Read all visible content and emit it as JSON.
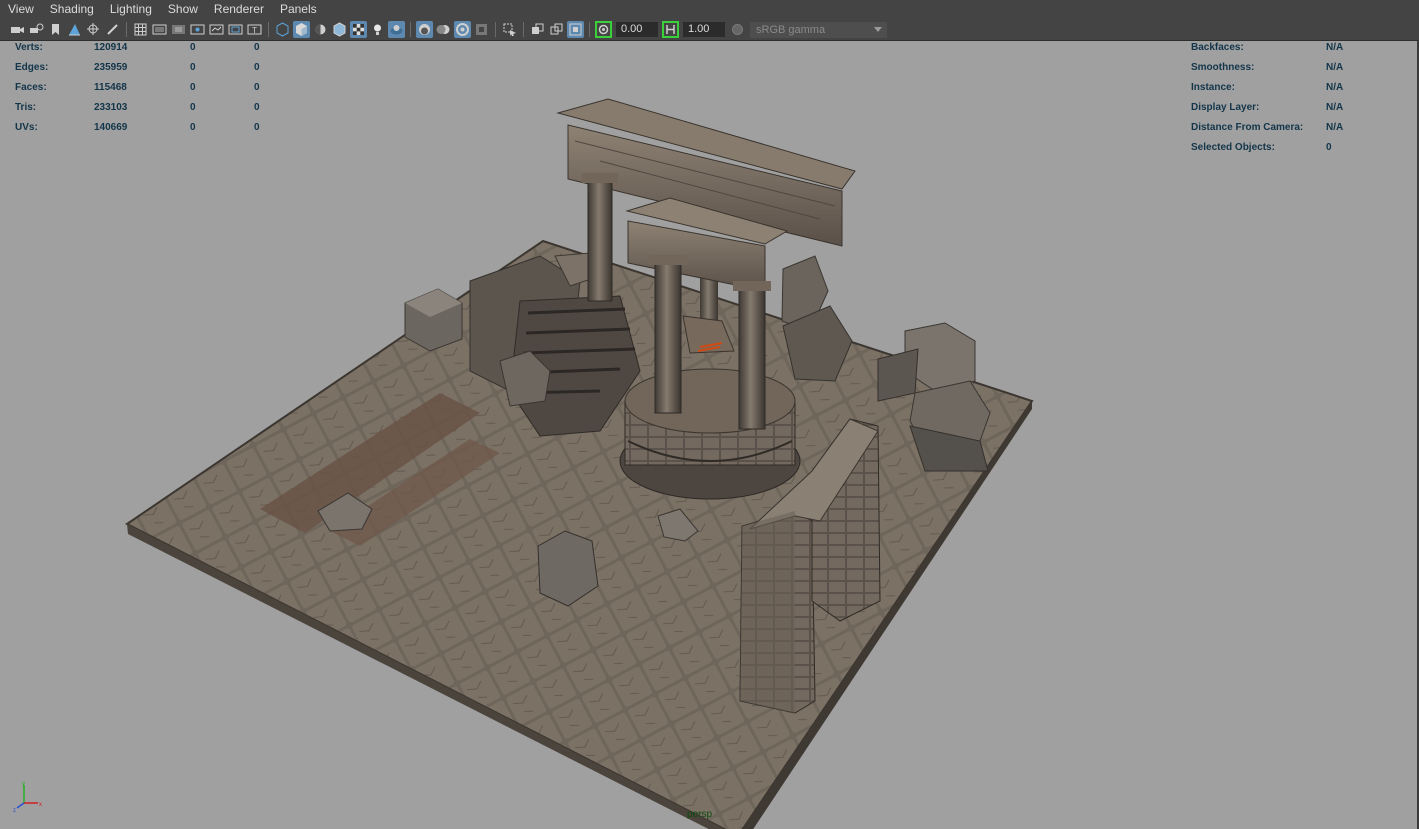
{
  "menus": [
    "View",
    "Shading",
    "Lighting",
    "Show",
    "Renderer",
    "Panels"
  ],
  "toolbar": {
    "exposure": "0.00",
    "gamma": "1.00",
    "color_space": "sRGB gamma"
  },
  "hud_left": [
    {
      "label": "Verts:",
      "v1": "120914",
      "v2": "0",
      "v3": "0"
    },
    {
      "label": "Edges:",
      "v1": "235959",
      "v2": "0",
      "v3": "0"
    },
    {
      "label": "Faces:",
      "v1": "115468",
      "v2": "0",
      "v3": "0"
    },
    {
      "label": "Tris:",
      "v1": "233103",
      "v2": "0",
      "v3": "0"
    },
    {
      "label": "UVs:",
      "v1": "140669",
      "v2": "0",
      "v3": "0"
    }
  ],
  "hud_right": [
    {
      "label": "Backfaces:",
      "value": "N/A"
    },
    {
      "label": "Smoothness:",
      "value": "N/A"
    },
    {
      "label": "Instance:",
      "value": "N/A"
    },
    {
      "label": "Display Layer:",
      "value": "N/A"
    },
    {
      "label": "Distance From Camera:",
      "value": "N/A"
    },
    {
      "label": "Selected Objects:",
      "value": "0"
    }
  ],
  "camera_label": "persp",
  "colors": {
    "viewport_bg": "#a0a0a0",
    "chrome_bg": "#444444",
    "hud_text": "#13354a",
    "highlight": "#5d89b0"
  }
}
